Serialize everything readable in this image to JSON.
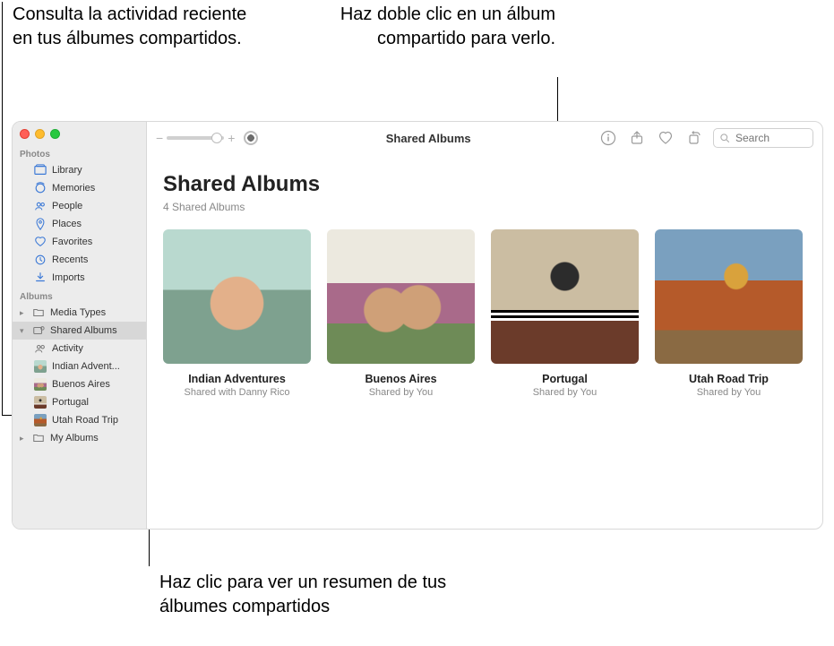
{
  "callouts": {
    "topLeft": "Consulta la actividad reciente en tus álbumes compartidos.",
    "topRight": "Haz doble clic en un álbum compartido para verlo.",
    "bottom": "Haz clic para ver un resumen de tus álbumes compartidos"
  },
  "toolbar": {
    "title": "Shared Albums",
    "search_placeholder": "Search"
  },
  "sidebar": {
    "sections": {
      "photos_label": "Photos",
      "albums_label": "Albums"
    },
    "photos": [
      {
        "icon": "library",
        "label": "Library"
      },
      {
        "icon": "memories",
        "label": "Memories"
      },
      {
        "icon": "people",
        "label": "People"
      },
      {
        "icon": "places",
        "label": "Places"
      },
      {
        "icon": "favorites",
        "label": "Favorites"
      },
      {
        "icon": "recents",
        "label": "Recents"
      },
      {
        "icon": "imports",
        "label": "Imports"
      }
    ],
    "albums": {
      "media_types": "Media Types",
      "shared_albums": "Shared Albums",
      "my_albums": "My Albums",
      "activity": "Activity",
      "children": [
        {
          "label": "Indian Advent...",
          "thumb": "thumb-indian"
        },
        {
          "label": "Buenos Aires",
          "thumb": "thumb-buenos"
        },
        {
          "label": "Portugal",
          "thumb": "thumb-portugal"
        },
        {
          "label": "Utah Road Trip",
          "thumb": "thumb-utah"
        }
      ]
    }
  },
  "page": {
    "title": "Shared Albums",
    "subtitle": "4 Shared Albums"
  },
  "albums_grid": [
    {
      "title": "Indian Adventures",
      "sub": "Shared with Danny Rico",
      "thumb": "thumb-indian"
    },
    {
      "title": "Buenos Aires",
      "sub": "Shared by You",
      "thumb": "thumb-buenos"
    },
    {
      "title": "Portugal",
      "sub": "Shared by You",
      "thumb": "thumb-portugal"
    },
    {
      "title": "Utah Road Trip",
      "sub": "Shared by You",
      "thumb": "thumb-utah"
    }
  ]
}
